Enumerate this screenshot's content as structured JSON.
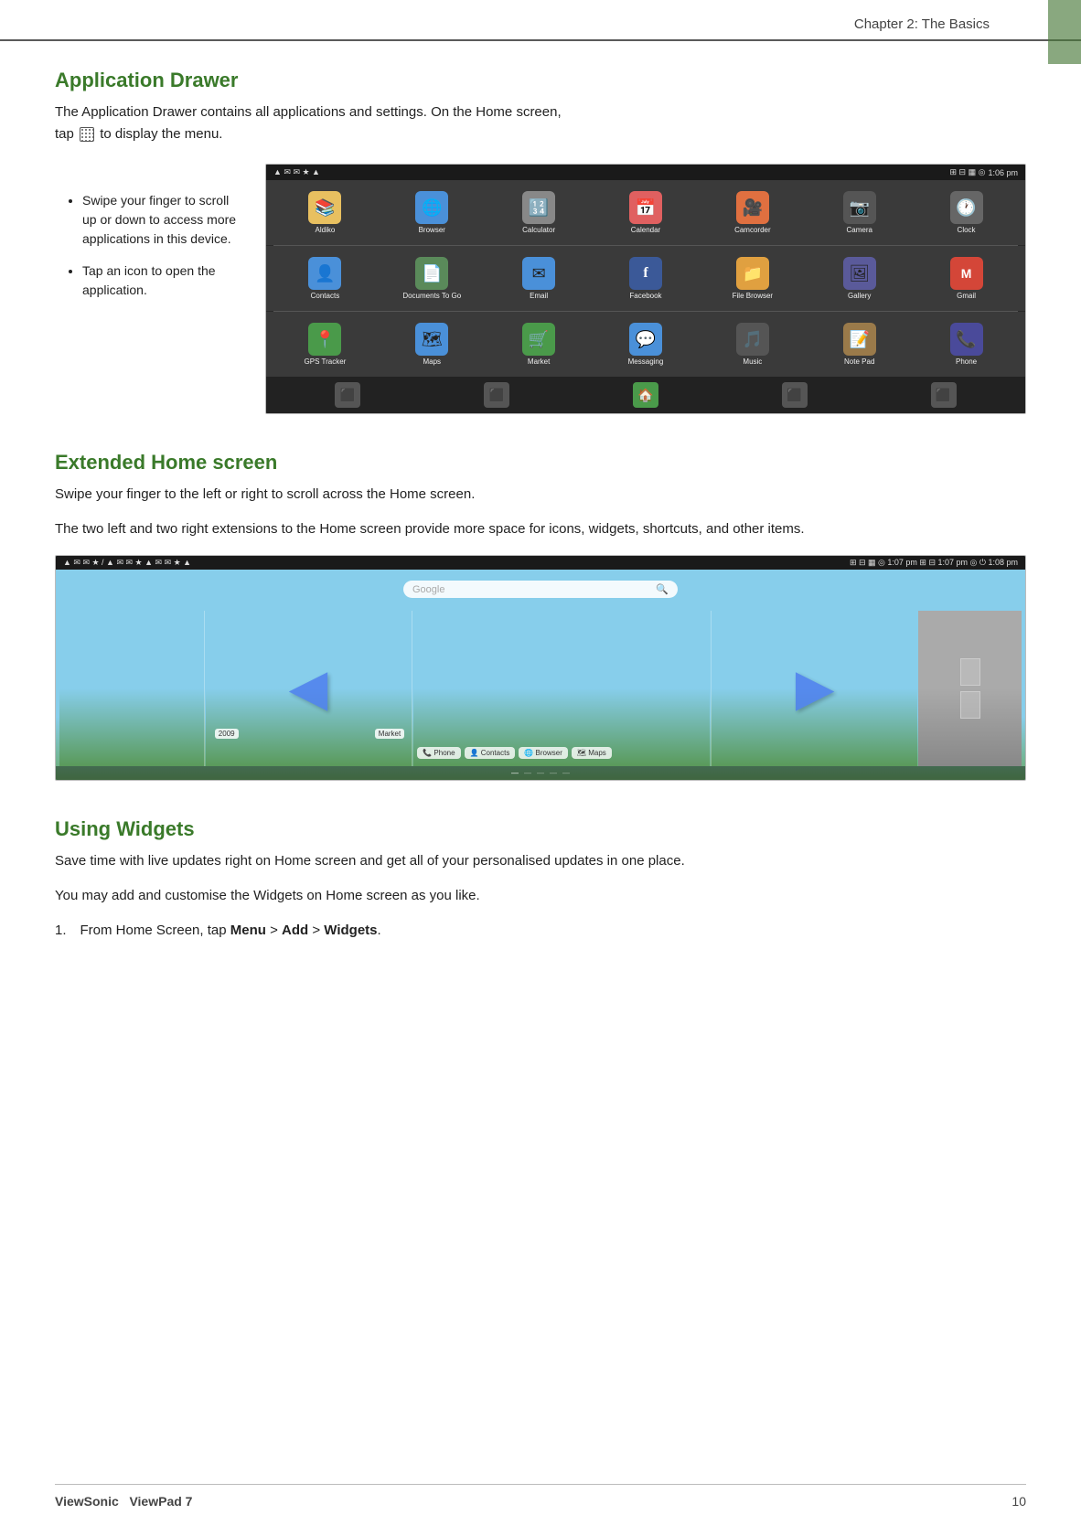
{
  "page": {
    "chapter_label": "Chapter 2: The Basics",
    "page_number": "10"
  },
  "footer": {
    "brand": "ViewSonic",
    "product": "ViewPad 7",
    "page_num": "10"
  },
  "app_drawer": {
    "section_title": "Application Drawer",
    "body1": "The Application Drawer contains all applications and settings. On the Home screen,",
    "body2": "to display the menu.",
    "tap_label": "tap",
    "bullets": [
      "Swipe your finger to scroll up or down to access more applications in this device.",
      "Tap an icon to open the application."
    ],
    "statusbar": {
      "time": "1:06 pm",
      "left_icons": "▲ ✉ ✉ ☆ ▲",
      "right_icons": "⊞ ⊟ ▦ ◎ ⏻"
    },
    "apps_row1": [
      {
        "name": "Aldiko",
        "icon": "📚",
        "color": "#e8c060"
      },
      {
        "name": "Browser",
        "icon": "🌐",
        "color": "#4a90d9"
      },
      {
        "name": "Calculator",
        "icon": "🔢",
        "color": "#888"
      },
      {
        "name": "Calendar",
        "icon": "📅",
        "color": "#e06060"
      },
      {
        "name": "Camcorder",
        "icon": "🎥",
        "color": "#e07040"
      },
      {
        "name": "Camera",
        "icon": "📷",
        "color": "#555"
      },
      {
        "name": "Clock",
        "icon": "🕐",
        "color": "#666"
      }
    ],
    "apps_row2": [
      {
        "name": "Contacts",
        "icon": "👤",
        "color": "#4a90d9"
      },
      {
        "name": "Documents To Go",
        "icon": "📄",
        "color": "#5a8a5a"
      },
      {
        "name": "Email",
        "icon": "✉",
        "color": "#4a90d9"
      },
      {
        "name": "Facebook",
        "icon": "f",
        "color": "#3b5998"
      },
      {
        "name": "File Browser",
        "icon": "📁",
        "color": "#e0a040"
      },
      {
        "name": "Gallery",
        "icon": "🖼",
        "color": "#5a5a9a"
      },
      {
        "name": "Gmail",
        "icon": "M",
        "color": "#d44638"
      }
    ],
    "apps_row3": [
      {
        "name": "GPS Tracker",
        "icon": "📍",
        "color": "#4a9a4a"
      },
      {
        "name": "Maps",
        "icon": "🗺",
        "color": "#4a90d9"
      },
      {
        "name": "Market",
        "icon": "🛒",
        "color": "#4a9a4a"
      },
      {
        "name": "Messaging",
        "icon": "💬",
        "color": "#4a90d9"
      },
      {
        "name": "Music",
        "icon": "🎵",
        "color": "#555"
      },
      {
        "name": "Note Pad",
        "icon": "📝",
        "color": "#9a7a4a"
      },
      {
        "name": "Phone",
        "icon": "📞",
        "color": "#4a4a9a"
      }
    ]
  },
  "extended_home": {
    "section_title": "Extended Home screen",
    "body1": "Swipe your finger to the left or right to scroll across the Home screen.",
    "body2": "The two left and two right extensions to the Home screen provide more space for icons, widgets, shortcuts, and other items.",
    "statusbar_left": "▲ ✉ ✉ ☆ / ▲ ✉ ✉ ☆ ▲ ✉ ✉ ☆ ▲",
    "statusbar_right": "⊞ ⊟ ▦ ◎ 1:07 pm ⊞ ⊟ 1:07 pm ◎ ⏻ 1:08 pm",
    "google_placeholder": "Google",
    "search_hint": "🔍"
  },
  "using_widgets": {
    "section_title": "Using Widgets",
    "body1": "Save time with live updates right on Home screen and get all of your personalised updates in one place.",
    "body2": "You may add and customise the Widgets on Home screen as you like.",
    "step1_prefix": "1. From Home Screen, tap ",
    "step1_bold": "Menu",
    "step1_mid": " > ",
    "step1_bold2": "Add",
    "step1_mid2": " > ",
    "step1_bold3": "Widgets",
    "step1_end": "."
  }
}
